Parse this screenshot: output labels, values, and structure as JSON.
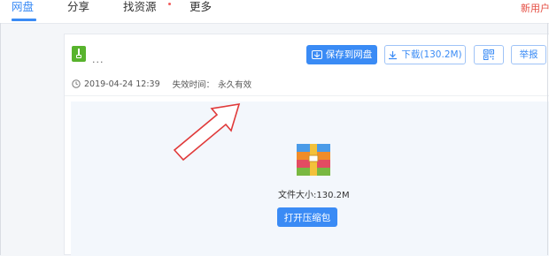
{
  "nav": {
    "items": [
      {
        "label": "网盘",
        "active": true
      },
      {
        "label": "分享",
        "active": false
      },
      {
        "label": "找资源",
        "active": false
      },
      {
        "label": "更多",
        "active": false
      }
    ],
    "promo_text": "新用户"
  },
  "file": {
    "name": "...",
    "date": "2019-04-24 12:39",
    "expiry_label": "失效时间：",
    "expiry_value": "永久有效"
  },
  "actions": {
    "save_label": "保存到网盘",
    "download_label": "下载(130.2M)",
    "report_label": "举报"
  },
  "preview": {
    "size_text": "文件大小:130.2M",
    "open_label": "打开压缩包"
  },
  "colors": {
    "accent": "#3a8bf5",
    "file_icon": "#58b32d",
    "annotation_arrow": "#e03a3a"
  },
  "icons": [
    "clock-icon",
    "download-icon",
    "cloud-save-icon",
    "qrcode-icon",
    "archive-icon",
    "annotation-arrow"
  ]
}
